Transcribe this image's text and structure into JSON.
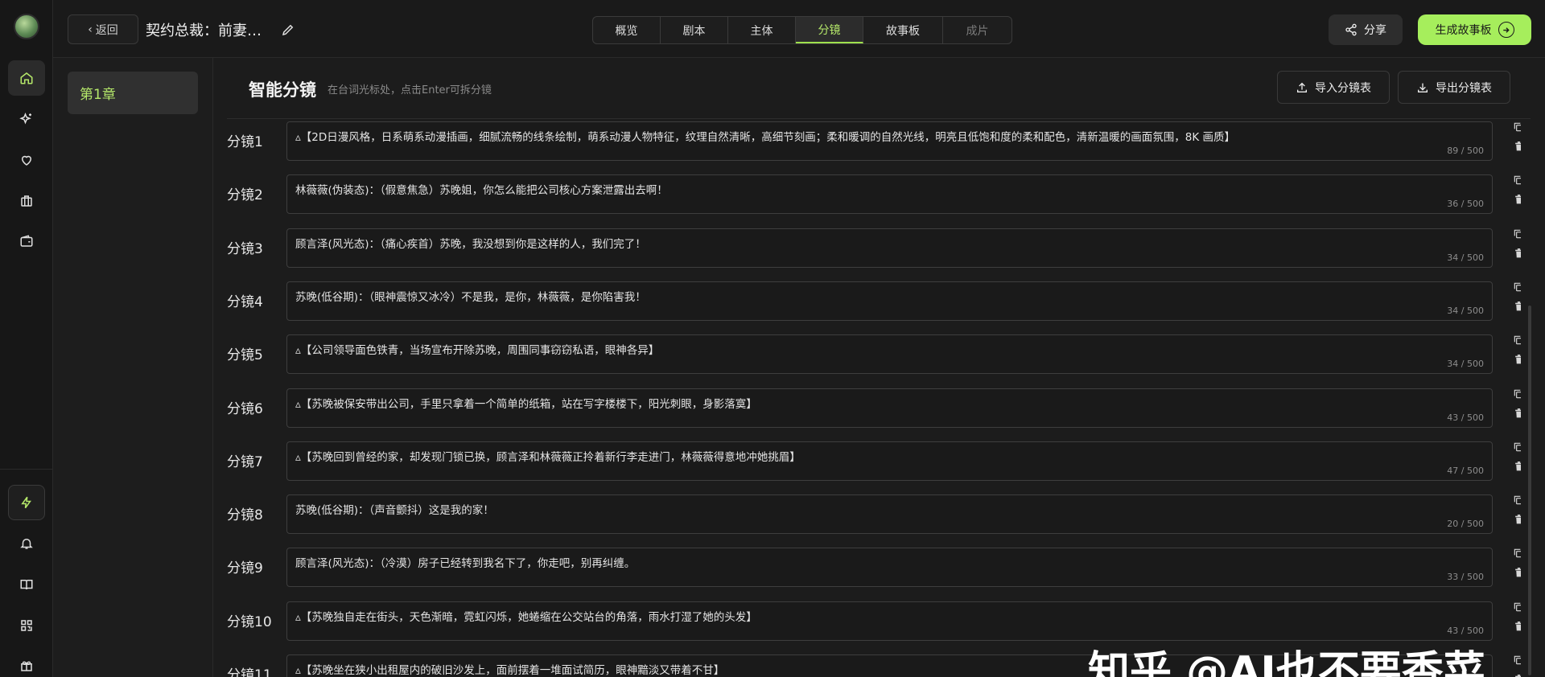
{
  "header": {
    "back_label": "返回",
    "project_title": "契约总裁：前妻…",
    "tabs": [
      {
        "label": "概览",
        "state": "normal"
      },
      {
        "label": "剧本",
        "state": "normal"
      },
      {
        "label": "主体",
        "state": "normal"
      },
      {
        "label": "分镜",
        "state": "active"
      },
      {
        "label": "故事板",
        "state": "normal"
      },
      {
        "label": "成片",
        "state": "disabled"
      }
    ],
    "share_label": "分享",
    "generate_label": "生成故事板"
  },
  "sidebar": {
    "icons": [
      "home-icon",
      "sparkle-icon",
      "heart-icon",
      "briefcase-icon",
      "wallet-icon",
      "bolt-icon",
      "bell-icon",
      "book-icon",
      "qrcode-icon",
      "gift-icon"
    ],
    "active": "home-icon"
  },
  "chapters": {
    "items": [
      {
        "label": "第1章",
        "active": true
      }
    ]
  },
  "main": {
    "title": "智能分镜",
    "hint": "在台词光标处，点击Enter可拆分镜",
    "import_label": "导入分镜表",
    "export_label": "导出分镜表"
  },
  "shots": [
    {
      "label": "分镜1",
      "text": "▵【2D日漫风格，日系萌系动漫插画，细腻流畅的线条绘制，萌系动漫人物特征，纹理自然清晰，高细节刻画；柔和暖调的自然光线，明亮且低饱和度的柔和配色，清新温暖的画面氛围，8K 画质】",
      "count": "89 / 500"
    },
    {
      "label": "分镜2",
      "text": "林薇薇(伪装态)：（假意焦急）苏晚姐，你怎么能把公司核心方案泄露出去啊！",
      "count": "36 / 500"
    },
    {
      "label": "分镜3",
      "text": "顾言泽(风光态)：（痛心疾首）苏晚，我没想到你是这样的人，我们完了！",
      "count": "34 / 500"
    },
    {
      "label": "分镜4",
      "text": "苏晚(低谷期)：（眼神震惊又冰冷）不是我，是你，林薇薇，是你陷害我！",
      "count": "34 / 500"
    },
    {
      "label": "分镜5",
      "text": "▵【公司领导面色铁青，当场宣布开除苏晚，周围同事窃窃私语，眼神各异】",
      "count": "34 / 500"
    },
    {
      "label": "分镜6",
      "text": "▵【苏晚被保安带出公司，手里只拿着一个简单的纸箱，站在写字楼楼下，阳光刺眼，身影落寞】",
      "count": "43 / 500"
    },
    {
      "label": "分镜7",
      "text": "▵【苏晚回到曾经的家，却发现门锁已换，顾言泽和林薇薇正拎着新行李走进门，林薇薇得意地冲她挑眉】",
      "count": "47 / 500"
    },
    {
      "label": "分镜8",
      "text": "苏晚(低谷期)：（声音颤抖）这是我的家！",
      "count": "20 / 500"
    },
    {
      "label": "分镜9",
      "text": "顾言泽(风光态)：（冷漠）房子已经转到我名下了，你走吧，别再纠缠。",
      "count": "33 / 500"
    },
    {
      "label": "分镜10",
      "text": "▵【苏晚独自走在街头，天色渐暗，霓虹闪烁，她蜷缩在公交站台的角落，雨水打湿了她的头发】",
      "count": "43 / 500"
    },
    {
      "label": "分镜11",
      "text": "▵【苏晚坐在狭小出租屋内的破旧沙发上，面前摆着一堆面试简历，眼神黯淡又带着不甘】",
      "count": ""
    }
  ],
  "watermark": "知乎 @AI也不要香菜",
  "colors": {
    "accent": "#a6ee5c",
    "background": "#1c1c1c"
  }
}
